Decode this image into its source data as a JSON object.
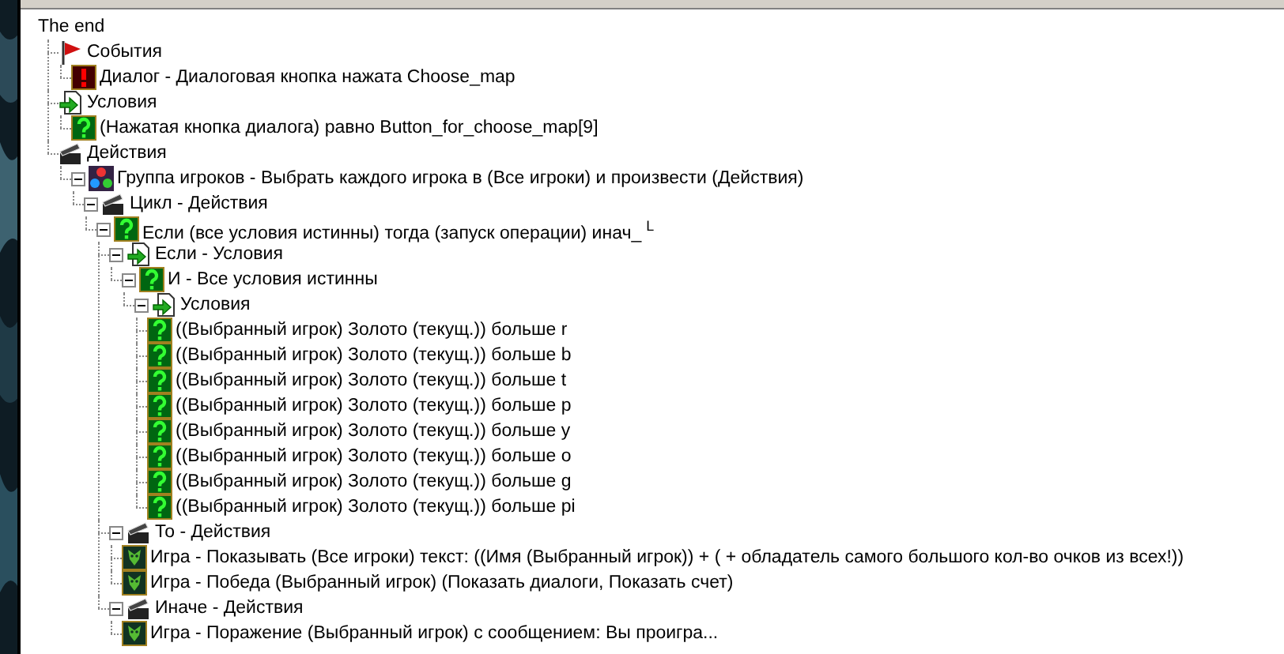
{
  "tree": {
    "label": "The end",
    "children": [
      {
        "label": "События",
        "kind": "events",
        "children": [
          {
            "label": "Диалог - Диалоговая кнопка нажата Choose_map",
            "kind": "event"
          }
        ]
      },
      {
        "label": "Условия",
        "kind": "conditions",
        "children": [
          {
            "label": "(Нажатая кнопка диалога) равно Button_for_choose_map[9]",
            "kind": "condition"
          }
        ]
      },
      {
        "label": "Действия",
        "kind": "actions",
        "children": [
          {
            "label": "Группа игроков - Выбрать каждого игрока в (Все игроки) и произвести (Действия)",
            "kind": "group",
            "expanded": true,
            "children": [
              {
                "label": "Цикл - Действия",
                "kind": "actions",
                "expanded": true,
                "children": [
                  {
                    "label": "Если (все условия истинны) тогда (запуск операции) инач_",
                    "tail": "L",
                    "kind": "condition",
                    "expanded": true,
                    "children": [
                      {
                        "label": "Если - Условия",
                        "kind": "conditions",
                        "expanded": true,
                        "children": [
                          {
                            "label": "И - Все условия истинны",
                            "kind": "condition",
                            "expanded": true,
                            "children": [
                              {
                                "label": "Условия",
                                "kind": "conditions",
                                "expanded": true,
                                "children": [
                                  {
                                    "label": "((Выбранный игрок) Золото (текущ.)) больше r",
                                    "kind": "condition"
                                  },
                                  {
                                    "label": "((Выбранный игрок) Золото (текущ.)) больше b",
                                    "kind": "condition"
                                  },
                                  {
                                    "label": "((Выбранный игрок) Золото (текущ.)) больше t",
                                    "kind": "condition"
                                  },
                                  {
                                    "label": "((Выбранный игрок) Золото (текущ.)) больше p",
                                    "kind": "condition"
                                  },
                                  {
                                    "label": "((Выбранный игрок) Золото (текущ.)) больше y",
                                    "kind": "condition"
                                  },
                                  {
                                    "label": "((Выбранный игрок) Золото (текущ.)) больше o",
                                    "kind": "condition"
                                  },
                                  {
                                    "label": "((Выбранный игрок) Золото (текущ.)) больше g",
                                    "kind": "condition"
                                  },
                                  {
                                    "label": "((Выбранный игрок) Золото (текущ.)) больше pi",
                                    "kind": "condition"
                                  }
                                ]
                              }
                            ]
                          }
                        ]
                      },
                      {
                        "label": "То - Действия",
                        "kind": "actions",
                        "expanded": true,
                        "children": [
                          {
                            "label": "Игра - Показывать (Все игроки) текст: ((Имя (Выбранный игрок)) + (  + обладатель самого большого кол-во очков из всех!))",
                            "kind": "action"
                          },
                          {
                            "label": "Игра - Победа (Выбранный игрок) (Показать диалоги, Показать счет)",
                            "kind": "action"
                          }
                        ]
                      },
                      {
                        "label": "Иначе - Действия",
                        "kind": "actions",
                        "expanded": true,
                        "children": [
                          {
                            "label": "Игра - Поражение (Выбранный игрок) с сообщением: Вы проигра...",
                            "kind": "action"
                          }
                        ]
                      }
                    ]
                  }
                ]
              }
            ]
          }
        ]
      }
    ]
  }
}
